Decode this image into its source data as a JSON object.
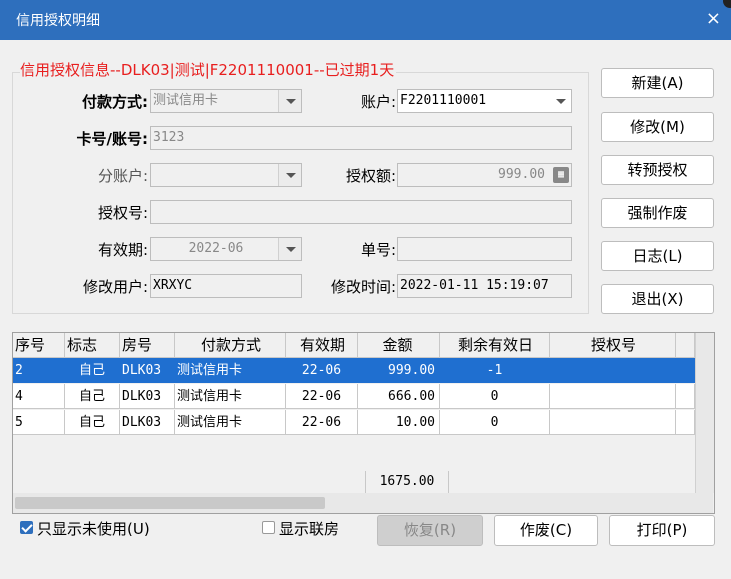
{
  "window": {
    "title": "信用授权明细",
    "close_glyph": "×"
  },
  "group": {
    "title": "信用授权信息--DLK03|测试|F2201110001--已过期1天"
  },
  "form": {
    "payment_method_label": "付款方式:",
    "payment_method_value": "测试信用卡",
    "account_label": "账户:",
    "account_value": "F2201110001",
    "card_label": "卡号/账号:",
    "card_value": "3123",
    "sub_account_label": "分账户:",
    "sub_account_value": "",
    "auth_amount_label": "授权额:",
    "auth_amount_value": "999.00",
    "auth_no_label": "授权号:",
    "auth_no_value": "",
    "valid_label": "有效期:",
    "valid_value": "2022-06",
    "bill_no_label": "单号:",
    "bill_no_value": "",
    "modify_user_label": "修改用户:",
    "modify_user_value": "XRXYC",
    "modify_time_label": "修改时间:",
    "modify_time_value": "2022-01-11 15:19:07"
  },
  "side_buttons": {
    "new": "新建(A)",
    "modify": "修改(M)",
    "pre_auth": "转预授权",
    "force_void": "强制作废",
    "log": "日志(L)",
    "exit": "退出(X)"
  },
  "table": {
    "headers": [
      "序号",
      "标志",
      "房号",
      "付款方式",
      "有效期",
      "金额",
      "剩余有效日",
      "授权号"
    ],
    "rows": [
      [
        "2",
        "自己",
        "DLK03",
        "测试信用卡",
        "22-06",
        "999.00",
        "-1",
        ""
      ],
      [
        "4",
        "自己",
        "DLK03",
        "测试信用卡",
        "22-06",
        "666.00",
        "0",
        ""
      ],
      [
        "5",
        "自己",
        "DLK03",
        "测试信用卡",
        "22-06",
        "10.00",
        "0",
        ""
      ]
    ],
    "selected_row": 0,
    "total": "1675.00"
  },
  "bottom": {
    "only_unused_label": "只显示未使用(U)",
    "only_unused_checked": true,
    "show_linked_label": "显示联房",
    "show_linked_checked": false,
    "restore": "恢复(R)",
    "void": "作废(C)",
    "print": "打印(P)"
  },
  "colors": {
    "titlebar": "#2e6fbd",
    "group_title": "#e81e1e",
    "selection": "#1f6fd0"
  }
}
